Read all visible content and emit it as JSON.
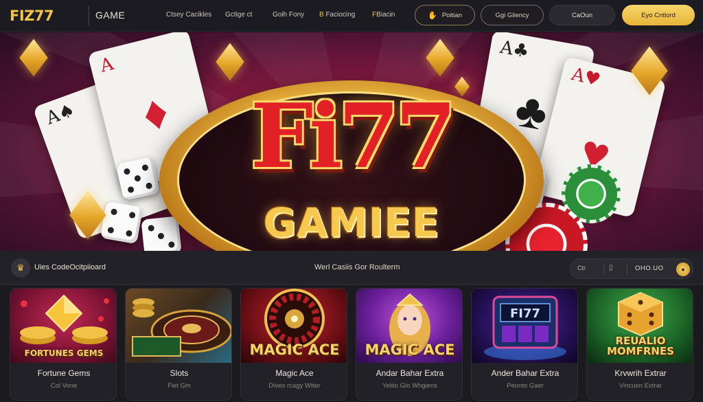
{
  "header": {
    "logo": "FIZ77",
    "game_label": "GAME",
    "nav_links": [
      {
        "label": "Ctsey Cacikles"
      },
      {
        "label": "Gctige ct"
      },
      {
        "label": "Goih Fony"
      },
      {
        "label": "Faciocing",
        "prefix": "B"
      },
      {
        "label": "Biacin",
        "prefix": "F"
      }
    ],
    "buttons": {
      "pill_a": "Poitian",
      "pill_b": "Ggi Gliency",
      "pill_c": "CaOun",
      "pill_d": "Eyo Cntlord"
    }
  },
  "hero": {
    "logo_top": "Fi77",
    "logo_bottom": "GAMIEE"
  },
  "infobar": {
    "left_text": "Uies CodeOcitpiioard",
    "center_text": "Werl Casiis Gor Roulterm",
    "pill_left": "Ctr",
    "pill_value": "OHO.UO"
  },
  "games": [
    {
      "thumb_label": "FORTUNES  GEMS",
      "title": "Fortune Gems",
      "subtitle": "Col Vone"
    },
    {
      "thumb_label": "",
      "title": "Slots",
      "subtitle": "Fiet Gm"
    },
    {
      "thumb_label": "MAGIC ACE",
      "title": "Magic Ace",
      "subtitle": "Diveo rcagy Wtter"
    },
    {
      "thumb_label": "MAGIC ACE",
      "title": "Andar Bahar Extra",
      "subtitle": "Yeltio Gio Whgiens"
    },
    {
      "thumb_label": "",
      "title": "Ander Bahar Extra",
      "subtitle": "Peonto Gaer"
    },
    {
      "thumb_label": "REUALIO  MOMFRNES",
      "title": "Krvwrih Extrar",
      "subtitle": "Vincuon Extrar"
    }
  ],
  "colors": {
    "accent_gold": "#f1c54a",
    "page_bg": "#17161b",
    "hero_red": "#c2234f",
    "logo_red": "#e42027"
  }
}
